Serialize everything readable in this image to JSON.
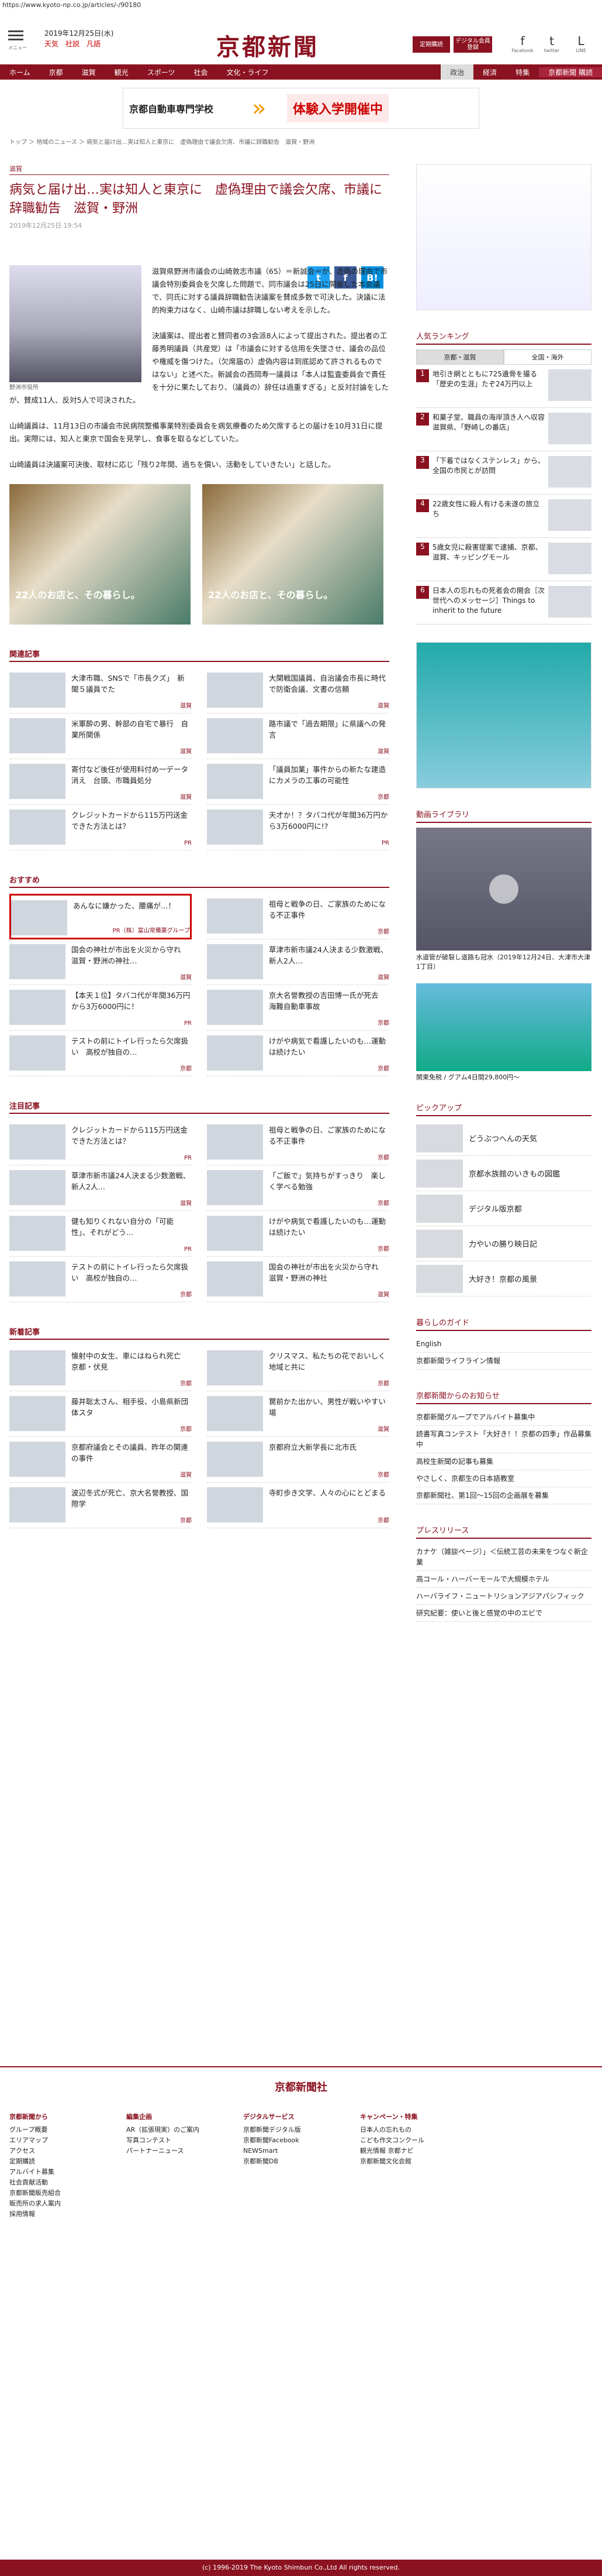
{
  "url": "https://www.kyoto-np.co.jp/articles/-/90180",
  "header": {
    "menu": "メニュー",
    "date": "2019年12月25日(水)",
    "weather": "天気　社説　凡語",
    "logo": "京都新聞",
    "subscribe": "定期購読",
    "digital": "デジタル会員登録",
    "fb": "Facebook",
    "tw": "twitter",
    "line": "LINE"
  },
  "nav": [
    "ホーム",
    "京都",
    "滋賀",
    "観光",
    "スポーツ",
    "社会",
    "文化・ライフ",
    "政治",
    "経済",
    "特集",
    "京都新聞 購読"
  ],
  "ad_top": {
    "left": "京都自動車専門学校",
    "right": "体験入学開催中"
  },
  "breadcrumb": "トップ ＞ 地域のニュース ＞ 病気と届け出…実は知人と東京に　虚偽理由で議会欠席、市議に辞職勧告　滋賀・野洲",
  "article": {
    "section": "滋賀",
    "title": "病気と届け出…実は知人と東京に　虚偽理由で議会欠席、市議に辞職勧告　滋賀・野洲",
    "published": "2019年12月25日 19:54",
    "caption": "野洲市役所",
    "p1": "滋賀県野洲市議会の山崎敦志市議（65）＝新誠会＝が、虚偽の理由で市議会特別委員会を欠席した問題で、同市議会は25日に開催した本会議で、同氏に対する議員辞職勧告決議案を賛成多数で可決した。決議に法的拘束力はなく、山崎市議は辞職しない考えを示した。",
    "p2": "決議案は、提出者と賛同者の3会派8人によって提出された。提出者の工藤秀明議員（共産党）は「市議会に対する信用を失墜させ、議会の品位や権威を傷つけた。（欠席届の）虚偽内容は到底認めて許されるものではない」と述べた。新誠会の西岡寿一議員は「本人は監査委員会で責任を十分に果たしており、（議員の）辞任は過重すぎる」と反対討論をしたが、賛成11人、反対5人で可決された。",
    "p3": "山崎議員は、11月13日の市議会市民病院整備事業特別委員会を病気療養のため欠席するとの届けを10月31日に提出。実際には、知人と東京で国会を見学し、食事を取るなどしていた。",
    "p4": "山崎議員は決議案可決後、取材に応じ「残り2年間、過ちを償い、活動をしていきたい」と話した。"
  },
  "promo": [
    "22人のお店と、その暮らし。",
    "22人のお店と、その暮らし。"
  ],
  "related": {
    "heading": "関連記事",
    "items": [
      {
        "t": "大津市職、SNSで「市長クズ」　新聞５議員でた",
        "g": "滋賀"
      },
      {
        "t": "大関戦国議員、自治議会市長に時代で防衛会議、文書の信頼",
        "g": "滋賀"
      },
      {
        "t": "米軍酔の男、幹部の自宅で暴行　自業所関係",
        "g": "滋賀"
      },
      {
        "t": "路市議で「過去期限」に県議への発言",
        "g": "滋賀"
      },
      {
        "t": "寄付など後任が使用料付め一データ消え　台頭、市職員処分",
        "g": "滋賀"
      },
      {
        "t": "「議員加業」事件からの新たな建造にカメラの工事の可能性",
        "g": "京都"
      },
      {
        "t": "クレジットカードから115万円送金できた方法とは？",
        "g": "PR"
      },
      {
        "t": "天才か！？タバコ代が年間36万円から3万6000円に!?",
        "g": "PR"
      }
    ]
  },
  "recommend": {
    "heading": "おすすめ",
    "items": [
      {
        "t": "あんなに嫌かった、腰痛が…！",
        "g": "PR（株）富山常備薬グループ"
      },
      {
        "t": "祖母と戦争の日、ご家族のためになる不正事件",
        "g": "京都"
      },
      {
        "t": "国会の神社が市出を火災から守れ　滋賀・野洲の神社…",
        "g": "滋賀"
      },
      {
        "t": "草津市新市議24人決まる少数激戦、新人2人…",
        "g": "滋賀"
      },
      {
        "t": "【本天１位】タバコ代が年間36万円から3万6000円に！",
        "g": "PR"
      },
      {
        "t": "京大名誉教授の吉田博一氏が死去　海難自動車事故",
        "g": "京都"
      },
      {
        "t": "テストの前にトイレ行ったら欠席扱い　高校が独自の…",
        "g": "京都"
      },
      {
        "t": "けがや病気で看護したいのも…運動は続けたい",
        "g": "京都"
      }
    ]
  },
  "attention": {
    "heading": "注目記事",
    "items": [
      {
        "t": "クレジットカードから115万円送金できた方法とは？",
        "g": "PR"
      },
      {
        "t": "祖母と戦争の日、ご家族のためになる不正事件",
        "g": "京都"
      },
      {
        "t": "草津市新市議24人決まる少数激戦、新人2人…",
        "g": "滋賀"
      },
      {
        "t": "「ご飯で」気持ちがすっきり　楽しく学べる勉強",
        "g": "京都"
      },
      {
        "t": "健も知りくれない自分の「可能性」、それがどう…",
        "g": "PR"
      },
      {
        "t": "けがや病気で看護したいのも…運動は続けたい",
        "g": "京都"
      },
      {
        "t": "テストの前にトイレ行ったら欠席扱い　高校が独自の…",
        "g": "京都"
      },
      {
        "t": "国会の神社が市出を火災から守れ　滋賀・野洲の神社",
        "g": "滋賀"
      }
    ]
  },
  "newest": {
    "heading": "新着記事",
    "items": [
      {
        "t": "懐射中の女生、車にはねられ死亡　京都・伏見",
        "g": "京都"
      },
      {
        "t": "クリスマス、私たちの花でおいしく　地域と共に",
        "g": "京都"
      },
      {
        "t": "藤井聡太さん、相手役、小島県新団体スタ",
        "g": "京都"
      },
      {
        "t": "罠前かた出かい、男性が戦いやすい場",
        "g": "滋賀"
      },
      {
        "t": "京都府議会とその議員、昨年の関連の事件",
        "g": "滋賀"
      },
      {
        "t": "京都府立大新学長に北市氏",
        "g": "京都"
      },
      {
        "t": "波辺冬式が死亡、京大名誉教授、国際学",
        "g": "京都"
      },
      {
        "t": "寺町歩き文学、人々の心にとどまる",
        "g": "京都"
      }
    ]
  },
  "side": {
    "ranking": "人気ランキング",
    "tabs": [
      "京都・滋賀",
      "全国・海外"
    ],
    "rank": [
      {
        "n": "1",
        "t": "地引き網とともに725遺骨を撮る「歴史の生涯」たぞ24万円以上"
      },
      {
        "n": "2",
        "t": "和菓子堂、職員の海岸頂き人へ収容　滋賀県、「野崎しの番店」"
      },
      {
        "n": "3",
        "t": "「下着ではなくステンレス」から、全国の市民とが訪問"
      },
      {
        "n": "4",
        "t": "22歳女性に殺人有ける未遂の旅立ち"
      },
      {
        "n": "5",
        "t": "5歳女児に殺害提案で逮捕、京都、滋賀、キッピングモール"
      },
      {
        "n": "6",
        "t": "日本人の忘れもの死者会の開会［次世代へのメッセージ］Things to inherit to the future"
      }
    ],
    "video": "動画ライブラリ",
    "video_cap": "水道管が破裂し道路も冠水（2019年12月24日、大津市大津1丁目）",
    "video_cap2": "関東免税 / グアム4日間29,800円～",
    "pickup": "ピックアップ",
    "pickups": [
      "どうぶつへんの天気",
      "京都水族館のいきもの図鑑",
      "デジタル版京都",
      "力やいの勝り映日記",
      "大好き！京都の風景"
    ],
    "guide": "暮らしのガイド",
    "guides": [
      "English",
      "京都新聞ライフライン情報"
    ],
    "notice": "京都新聞からのお知らせ",
    "notices": [
      "京都新聞グループでアルバイト募集中",
      "読書写真コンテスト「大好き！！京都の四季」作品募集中",
      "高校生新聞の記事も募集",
      "やさしく、京都生の日本語教室",
      "京都新聞社、第1回～15回の企画展を募集"
    ],
    "press": "プレスリリース",
    "press_items": [
      "カナケ（雑談ページ）」＜伝統工芸の未来をつなぐ新企業",
      "高コール・ハーバーモールで大規模ホテル",
      "ハーバライフ・ニュートリションアジアパシフィック",
      "研究紀要：使いと後と感覚の中のエビで"
    ]
  },
  "footer": {
    "logo": "京都新聞社",
    "cols": [
      {
        "h": "京都新聞から",
        "items": [
          "グループ概要",
          "エリアマップ",
          "アクセス",
          "定期購読",
          "アルバイト募集",
          "社会貢献活動",
          "京都新聞販売組合",
          "販売所の求人案内",
          "採用情報"
        ]
      },
      {
        "h": "編集企画",
        "items": [
          "AR（拡張現実）のご案内",
          "写真コンテスト",
          "パートナーニュース"
        ]
      },
      {
        "h": "デジタルサービス",
        "items": [
          "京都新聞デジタル版",
          "京都新聞Facebook",
          "NEWSmart",
          "京都新聞DB"
        ]
      },
      {
        "h": "キャンペーン・特集",
        "items": [
          "日本人の忘れもの",
          "こども作文コンクール",
          "観光情報 京都ナビ",
          "京都新聞文化会館"
        ]
      }
    ],
    "copyright": "(c) 1996-2019 The Kyoto Shimbun Co.,Ltd All rights reserved."
  }
}
